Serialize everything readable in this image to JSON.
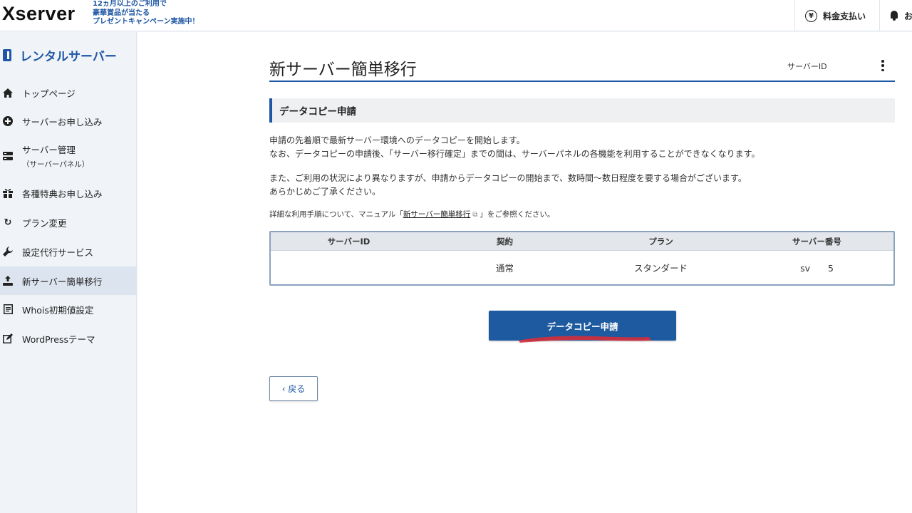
{
  "header": {
    "logo": "Xserver",
    "campaign_lines": [
      "12ヵ月以上のご利用で",
      "豪華賞品が当たる",
      "プレゼントキャンペーン実施中！"
    ],
    "pay_label": "料金支払い",
    "pay_icon": "yen-icon",
    "bell_label": "お",
    "bell_icon": "bell-icon"
  },
  "sidebar": {
    "title": "レンタルサーバー",
    "items": [
      {
        "label": "トップページ",
        "icon": "home-icon",
        "active": false
      },
      {
        "label": "サーバーお申し込み",
        "icon": "plus-circle-icon",
        "active": false
      },
      {
        "label": "サーバー管理",
        "sub": "（サーバーパネル）",
        "icon": "server-icon",
        "active": false
      },
      {
        "label": "各種特典お申し込み",
        "icon": "gift-icon",
        "active": false
      },
      {
        "label": "プラン変更",
        "icon": "refresh-icon",
        "active": false
      },
      {
        "label": "設定代行サービス",
        "icon": "wrench-icon",
        "active": false
      },
      {
        "label": "新サーバー簡単移行",
        "icon": "transfer-icon",
        "active": true
      },
      {
        "label": "Whois初期値設定",
        "icon": "document-icon",
        "active": false
      },
      {
        "label": "WordPressテーマ",
        "icon": "edit-icon",
        "active": false
      }
    ]
  },
  "main": {
    "title": "新サーバー簡単移行",
    "server_id_label": "サーバーID",
    "section_title": "データコピー申請",
    "para1_line1": "申請の先着順で最新サーバー環境へのデータコピーを開始します。",
    "para1_line2": "なお、データコピーの申請後、「サーバー移行確定」までの間は、サーバーパネルの各機能を利用することができなくなります。",
    "para2_line1": "また、ご利用の状況により異なりますが、申請からデータコピーの開始まで、数時間～数日程度を要する場合がございます。",
    "para2_line2": "あらかじめご了承ください。",
    "manual_prefix": "詳細な利用手順について、マニュアル「",
    "manual_link": "新サーバー簡単移行",
    "manual_suffix": "」をご参照ください。",
    "table": {
      "headers": [
        "サーバーID",
        "契約",
        "プラン",
        "サーバー番号"
      ],
      "row": [
        "",
        "通常",
        "スタンダード",
        "sv　　5"
      ]
    },
    "copy_button": "データコピー申請",
    "back_button": "‹ 戻る",
    "annotation_color": "#d32f3a",
    "accent_color": "#1f57a4"
  }
}
